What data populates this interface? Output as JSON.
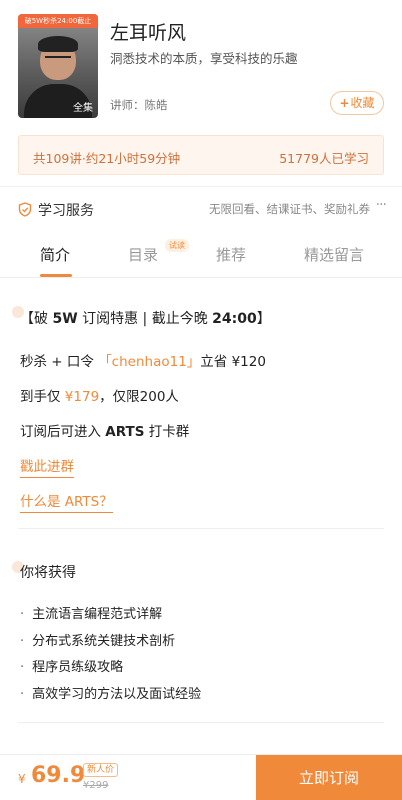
{
  "course": {
    "cover_ribbon": "破5W秒杀24:00截止",
    "cover_tag": "全集",
    "title": "左耳听风",
    "subtitle": "洞悉技术的本质，享受科技的乐趣",
    "teacher": "讲师：陈皓",
    "favorite_label": "收藏",
    "stats_lessons": "共109讲·约21小时59分钟",
    "stats_learners": "51779人已学习"
  },
  "service": {
    "label": "学习服务",
    "items": "无限回看、结课证书、奖励礼券",
    "more": "···"
  },
  "tabs": [
    {
      "label": "简介"
    },
    {
      "label": "目录",
      "badge": "试读"
    },
    {
      "label": "推荐"
    },
    {
      "label": "精选留言"
    }
  ],
  "promo": {
    "title_a": "【破 ",
    "title_b": "5W",
    "title_c": " 订阅特惠 | 截止今晚 ",
    "title_d": "24:00",
    "title_e": "】",
    "line1_a": "秒杀 + 口令 ",
    "line1_b": "「chenhao11」",
    "line1_c": "立省 ¥120",
    "line2_a": "到手仅 ",
    "line2_b": "¥179",
    "line2_c": "，仅限200人",
    "line3_a": "订阅后可进入 ",
    "line3_b": "ARTS",
    "line3_c": " 打卡群",
    "link1": "戳此进群",
    "link2": "什么是 ARTS？"
  },
  "gains": {
    "title": "你将获得",
    "items": [
      "主流语言编程范式详解",
      "分布式系统关键技术剖析",
      "程序员练级攻略",
      "高效学习的方法以及面试经验"
    ]
  },
  "bottom": {
    "currency": "¥",
    "price": "69.9",
    "newbie_label": "新人价",
    "original_price": "¥299",
    "subscribe_label": "立即订阅"
  },
  "colors": {
    "accent": "#f08a3a",
    "stats_bg": "#fdf5ee"
  }
}
